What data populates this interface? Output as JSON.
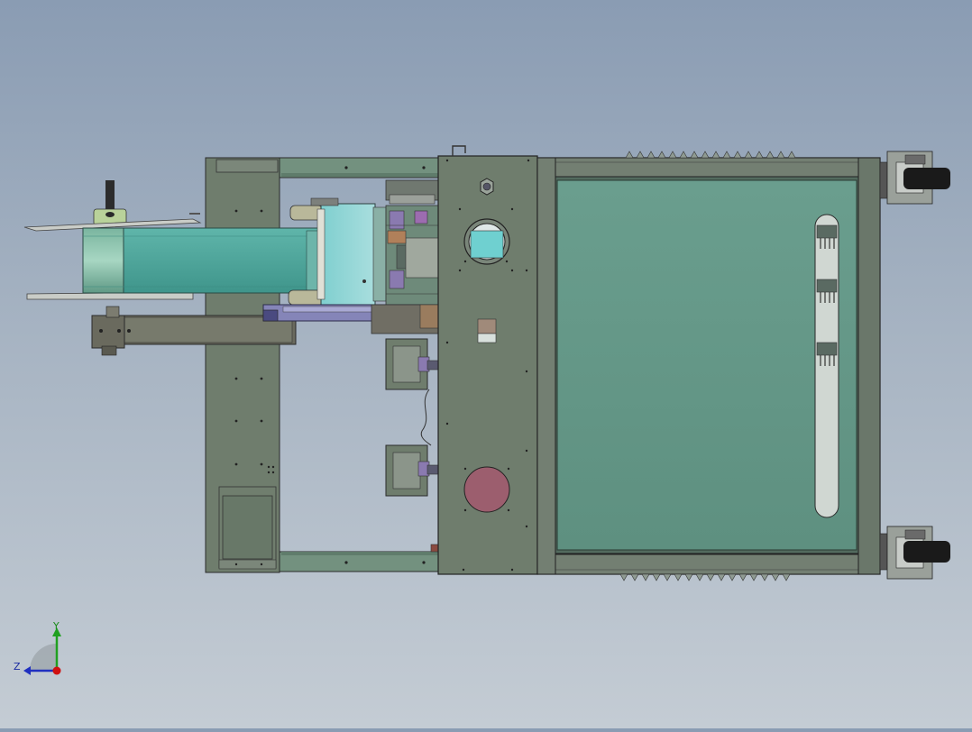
{
  "triad": {
    "y_label": "Y",
    "z_label": "Z"
  },
  "colors": {
    "background_top": "#8a9cb3",
    "background_bottom": "#c4ccd4",
    "frame_gray": "#6f7d6d",
    "frame_green": "#73917f",
    "panel_teal": "#639685",
    "belt_cyan": "#4ea59b",
    "port_pink": "#9c5e6e",
    "axis_y": "#20a020",
    "axis_z": "#2030c0",
    "axis_x": "#d01010"
  }
}
